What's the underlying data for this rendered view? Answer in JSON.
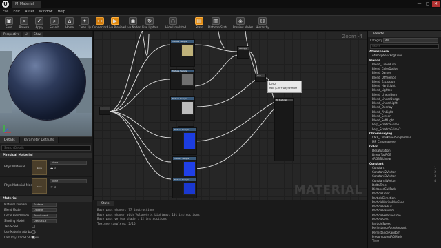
{
  "window": {
    "tab_title": "M_Material",
    "logo": "U",
    "controls": [
      "—",
      "▢",
      "✕"
    ]
  },
  "menu": [
    "File",
    "Edit",
    "Asset",
    "Window",
    "Help"
  ],
  "toolbar": [
    {
      "label": "Save",
      "icon": "save-icon",
      "glyph": "▣"
    },
    {
      "label": "Browse",
      "icon": "browse-icon",
      "glyph": "⌕"
    },
    {
      "label": "Apply",
      "icon": "apply-icon",
      "glyph": "✓"
    },
    {
      "label": "Search",
      "icon": "search-icon",
      "glyph": "⌕"
    },
    {
      "label": "Home",
      "icon": "home-icon",
      "glyph": "⌂"
    },
    {
      "label": "Clean Up",
      "icon": "clean-up-icon",
      "glyph": "✦"
    },
    {
      "label": "Connectors",
      "icon": "connectors-icon",
      "glyph": "⊶"
    },
    {
      "label": "Live Preview",
      "icon": "live-preview-icon",
      "glyph": "▶"
    },
    {
      "label": "Live Nodes",
      "icon": "live-nodes-icon",
      "glyph": "◉"
    },
    {
      "label": "Live Update",
      "icon": "live-update-icon",
      "glyph": "↻"
    },
    {
      "label": "Hide Unrelated",
      "icon": "hide-unrelated-icon",
      "glyph": "◌"
    },
    {
      "label": "Stats",
      "icon": "stats-icon",
      "glyph": "▤"
    },
    {
      "label": "Platform Stats",
      "icon": "platform-stats-icon",
      "glyph": "▥"
    },
    {
      "label": "Preview Nodes",
      "icon": "preview-nodes-icon",
      "glyph": "◈"
    },
    {
      "label": "Hierarchy",
      "icon": "hierarchy-icon",
      "glyph": "⌬"
    }
  ],
  "preview": {
    "chips": [
      "Perspective",
      "Lit",
      "Show"
    ]
  },
  "details": {
    "tabs": [
      "Details",
      "Parameter Defaults"
    ],
    "search_placeholder": "Search Details",
    "section_physical": "Physical Material",
    "phys_material_label": "Phys Material",
    "phys_material_mask_label": "Phys Material Mask",
    "thumb_text": "None",
    "dropdown_value": "None",
    "section_material": "Material",
    "rows": [
      {
        "k": "Material Domain",
        "v": "Surface"
      },
      {
        "k": "Blend Mode",
        "v": "Opaque"
      },
      {
        "k": "Decal Blend Mode",
        "v": "Translucent"
      },
      {
        "k": "Shading Model",
        "v": "Default Lit"
      },
      {
        "k": "Two Sided",
        "v": ""
      },
      {
        "k": "Use Material Attributes",
        "v": ""
      },
      {
        "k": "Cast Ray Traced Shadows",
        "v": ""
      }
    ]
  },
  "graph": {
    "zoom": "Zoom -4",
    "watermark": "MATERIAL",
    "tooltip_title": "Lerp",
    "tooltip_hint": "Hold (Ctrl + Alt) for more",
    "node_texture": "Texture Sample",
    "node_multiply": "Multiply",
    "node_lerp": "Lerp",
    "node_param": "Param",
    "node_material": "M_Material"
  },
  "stats": {
    "tab": "Stats",
    "lines": [
      "Base pass shader: 77 instructions",
      "Base pass shader with Volumetric Lightmap: 101 instructions",
      "Base pass vertex shader: 42 instructions",
      "Texture samplers: 2/16"
    ]
  },
  "palette": {
    "tab": "Palette",
    "category_label": "Category",
    "category_value": "All",
    "search_placeholder": "Search",
    "items": [
      {
        "t": "Atmosphere",
        "cat": true
      },
      {
        "t": "AtmosphericFogColor"
      },
      {
        "t": "Blends",
        "cat": true
      },
      {
        "t": "Blend_ColorBurn"
      },
      {
        "t": "Blend_ColorDodge"
      },
      {
        "t": "Blend_Darken"
      },
      {
        "t": "Blend_Difference"
      },
      {
        "t": "Blend_Exclusion"
      },
      {
        "t": "Blend_HardLight"
      },
      {
        "t": "Blend_Lighten"
      },
      {
        "t": "Blend_LinearBurn"
      },
      {
        "t": "Blend_LinearDodge"
      },
      {
        "t": "Blend_LinearLight"
      },
      {
        "t": "Blend_Overlay"
      },
      {
        "t": "Blend_PinLight"
      },
      {
        "t": "Blend_Screen"
      },
      {
        "t": "Blend_SoftLight"
      },
      {
        "t": "Lerp_ScratchGrime"
      },
      {
        "t": "Lerp_ScratchGrime2"
      },
      {
        "t": "Chromakeying",
        "cat": true
      },
      {
        "t": "CMY_ColorKeyerSingleParse"
      },
      {
        "t": "MF_Chromakeyer"
      },
      {
        "t": "Color",
        "cat": true
      },
      {
        "t": "Desaturation"
      },
      {
        "t": "LinearTosRGB"
      },
      {
        "t": "sRGBToLinear"
      },
      {
        "t": "Constant",
        "cat": true
      },
      {
        "t": "Constant",
        "hk": "1"
      },
      {
        "t": "Constant2Vector",
        "hk": "2"
      },
      {
        "t": "Constant3Vector",
        "hk": "3"
      },
      {
        "t": "Constant4Vector",
        "hk": "4"
      },
      {
        "t": "DeltaTime"
      },
      {
        "t": "DistanceCullFade"
      },
      {
        "t": "ParticleColor"
      },
      {
        "t": "ParticleDirection"
      },
      {
        "t": "ParticleMotionBlurFade"
      },
      {
        "t": "ParticleRadius"
      },
      {
        "t": "ParticleRandom"
      },
      {
        "t": "ParticleRelativeTime"
      },
      {
        "t": "ParticleSize"
      },
      {
        "t": "ParticleSpeed"
      },
      {
        "t": "PerInstanceFadeAmount"
      },
      {
        "t": "PerInstanceRandom"
      },
      {
        "t": "PrecomputedAOMask"
      },
      {
        "t": "Time"
      }
    ]
  },
  "colors": {
    "accent": "#e08a10",
    "texture_node_header": "#3a5a7a",
    "param_node_header": "#7a1a1a",
    "material_node_header": "#4a4a4a"
  }
}
